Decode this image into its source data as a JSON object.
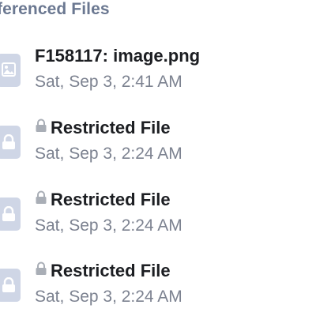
{
  "section": {
    "title": "ferenced Files"
  },
  "files": [
    {
      "title": "F158117: image.png",
      "date": "Sat, Sep 3, 2:41 AM",
      "icon": "image-file-icon",
      "restricted": false
    },
    {
      "title": "Restricted File",
      "date": "Sat, Sep 3, 2:24 AM",
      "icon": "lock-file-icon",
      "restricted": true
    },
    {
      "title": "Restricted File",
      "date": "Sat, Sep 3, 2:24 AM",
      "icon": "lock-file-icon",
      "restricted": true
    },
    {
      "title": "Restricted File",
      "date": "Sat, Sep 3, 2:24 AM",
      "icon": "lock-file-icon",
      "restricted": true
    }
  ],
  "colors": {
    "icon_bg": "#cfd6e6",
    "header": "#6b7891",
    "title": "#1c1e22",
    "date": "#7c8290",
    "lock": "#a9aeb6"
  }
}
